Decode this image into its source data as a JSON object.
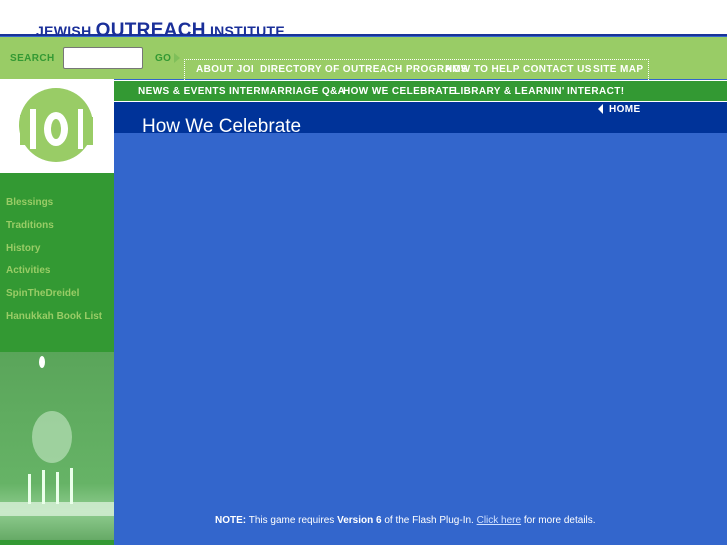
{
  "brand": {
    "part1": "JEWISH ",
    "part2": "OUTREACH",
    "part3": " INSTITUTE"
  },
  "search": {
    "label": "SEARCH",
    "value": "",
    "go": "GO"
  },
  "top_nav": [
    "ABOUT JOI",
    "DIRECTORY OF OUTREACH PROGRAMS",
    "HOW TO HELP",
    "CONTACT US",
    "SITE MAP"
  ],
  "main_nav": [
    "NEWS & EVENTS",
    "INTERMARRIAGE Q&A",
    "HOW WE CELEBRATE",
    "LIBRARY & LEARNIN'",
    "INTERACT!"
  ],
  "home": "HOME",
  "page_title": "How We Celebrate",
  "sidebar": [
    "Blessings",
    "Traditions",
    "History",
    "Activities",
    "SpinTheDreidel",
    "Hanukkah Book List"
  ],
  "note": {
    "prefix": "NOTE:",
    "t1": " This game requires ",
    "version": "Version 6",
    "t2": " of the Flash Plug-In. ",
    "link": "Click here",
    "t3": " for more details."
  },
  "logo": "JOI"
}
